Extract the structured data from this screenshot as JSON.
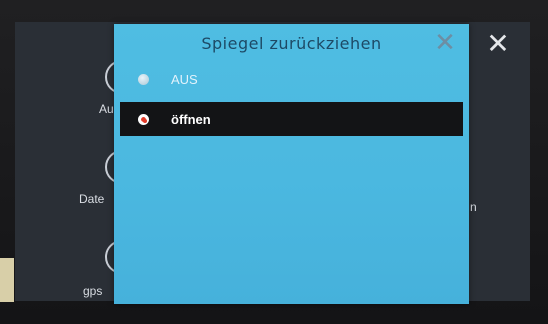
{
  "background_page": {
    "items": [
      {
        "label": "Au"
      },
      {
        "label": "Date"
      },
      {
        "label": "gps"
      }
    ],
    "right_fragment": "n",
    "close_icon": "close-icon"
  },
  "dialog": {
    "title": "Spiegel zurückziehen",
    "close_icon": "close-icon",
    "options": [
      {
        "label": "AUS",
        "selected": false
      },
      {
        "label": "öffnen",
        "selected": true
      }
    ],
    "colors": {
      "dialog_bg": "#4bb8e0",
      "selected_row_bg": "#131416",
      "selected_radio": "#e23b2a"
    }
  }
}
